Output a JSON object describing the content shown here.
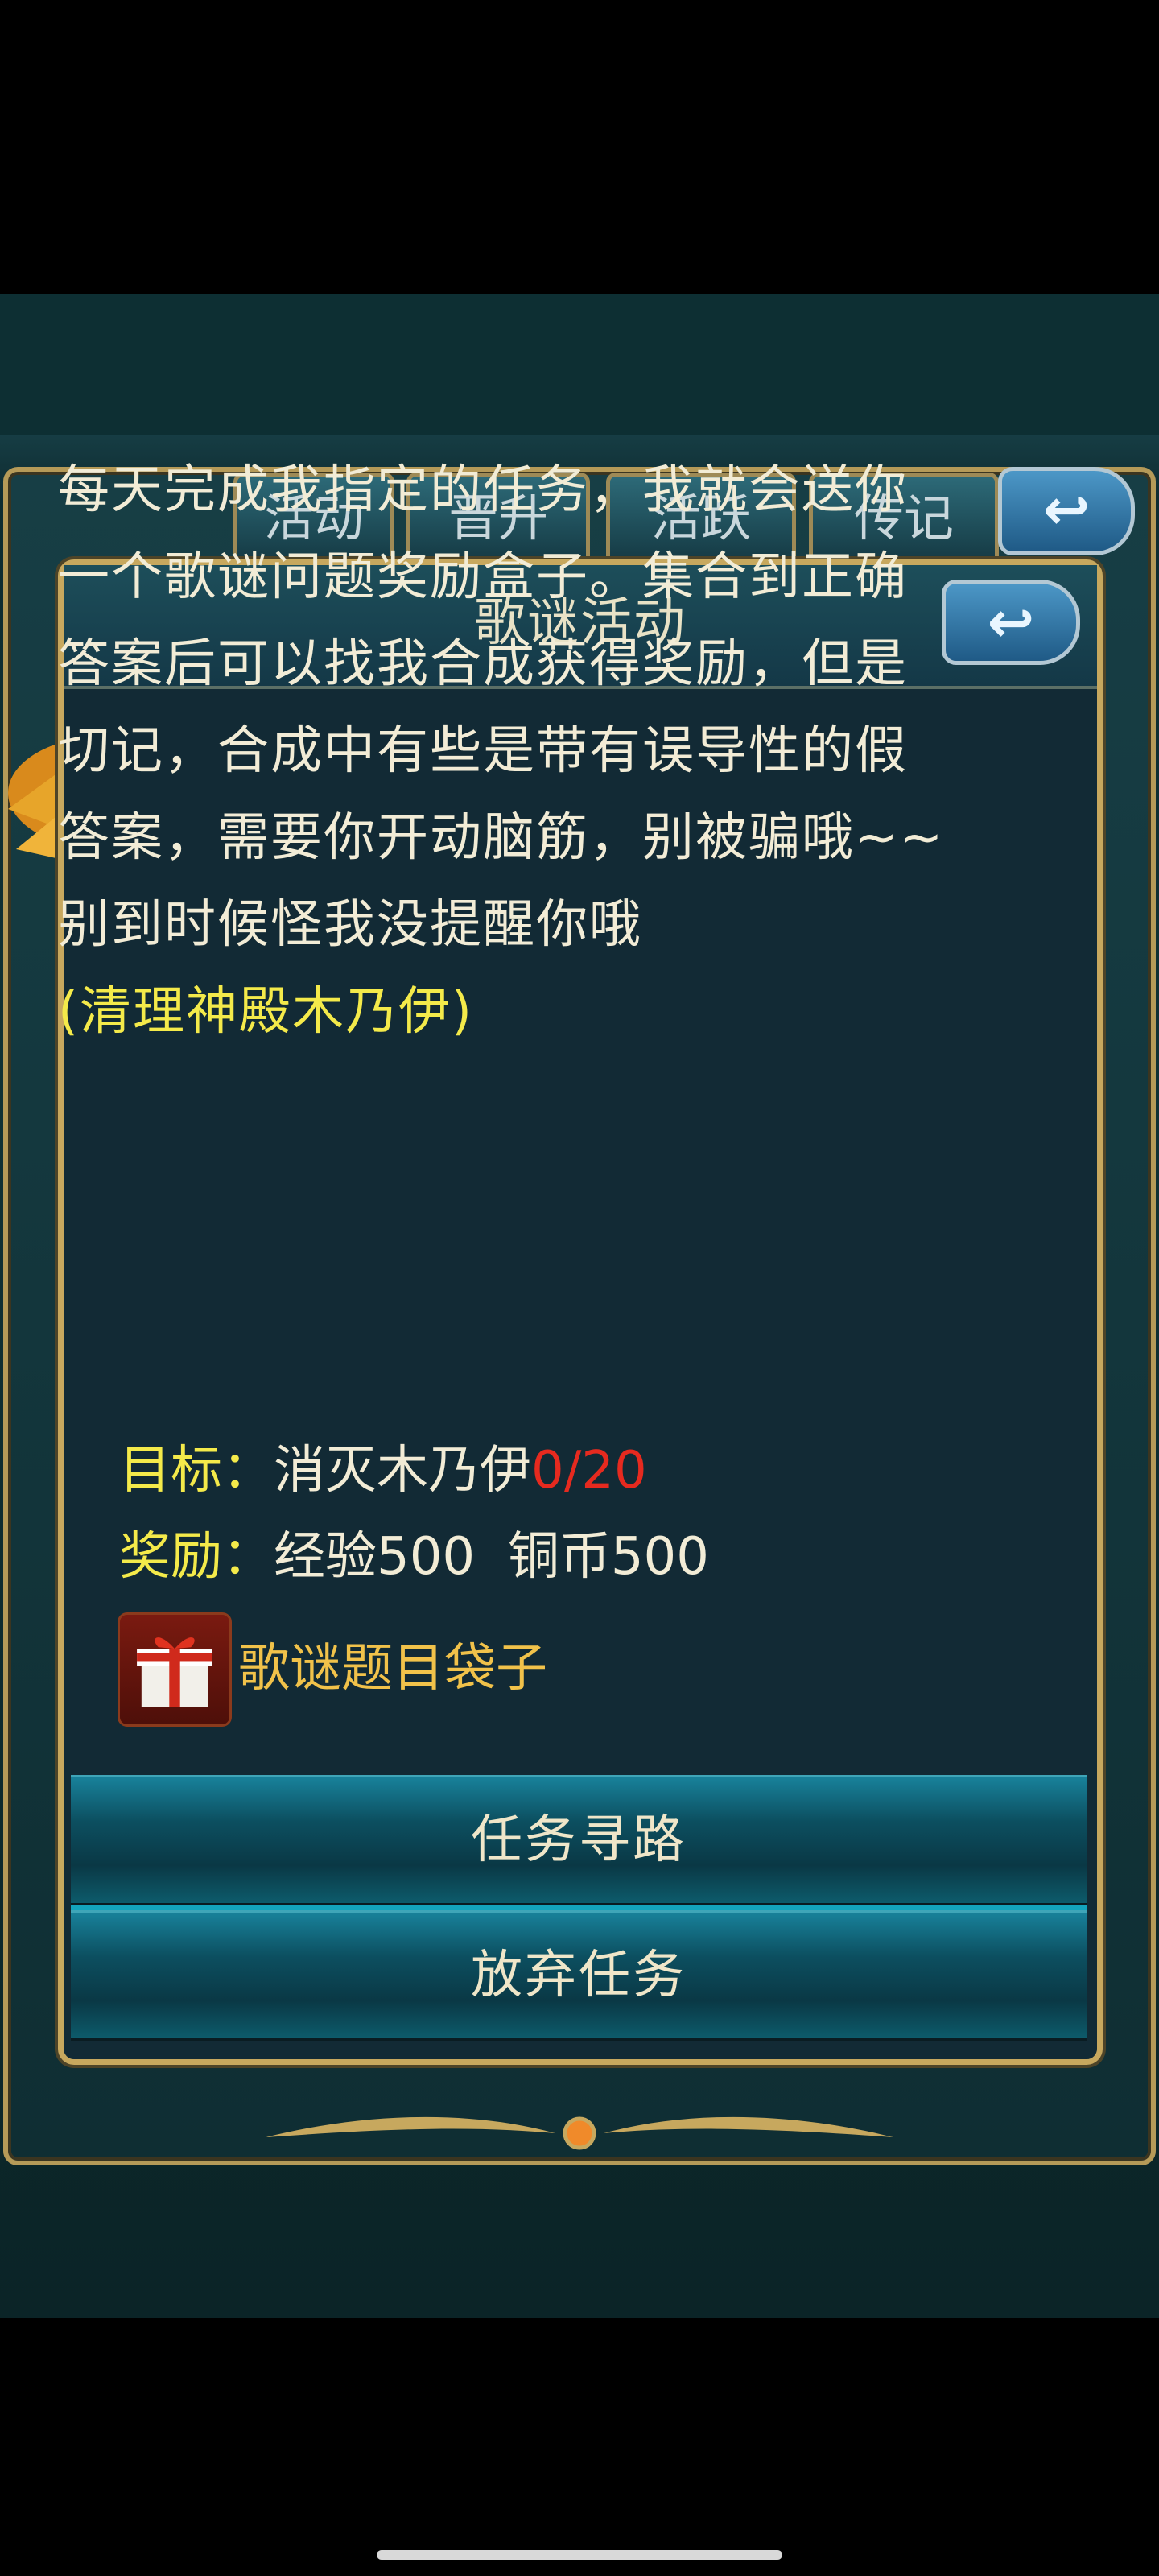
{
  "tabs": [
    "活动",
    "晋升",
    "活跃",
    "传记"
  ],
  "dialog": {
    "title": "歌谜活动",
    "description_lines": [
      "每天完成我指定的任务，我就会送你",
      "一个歌谜问题奖励盒子。集合到正确",
      "答案后可以找我合成获得奖励，但是",
      "切记，合成中有些是带有误导性的假",
      "答案，需要你开动脑筋，别被骗哦~~",
      "别到时候怪我没提醒你哦"
    ],
    "hint": "(清理神殿木乃伊)",
    "goal": {
      "label": "目标：",
      "text": "消灭木乃伊",
      "progress": "0/20"
    },
    "reward": {
      "label": "奖励：",
      "text": "经验500  铜币500"
    },
    "item": {
      "name": "歌谜题目袋子",
      "icon": "gift-box-icon"
    },
    "buttons": {
      "path": "任务寻路",
      "abandon": "放弃任务"
    }
  },
  "colors": {
    "accent_yellow": "#f4ea4a",
    "progress_red": "#e62a1f",
    "item_gold": "#f1c24a",
    "frame_gold": "#c7a85e"
  }
}
